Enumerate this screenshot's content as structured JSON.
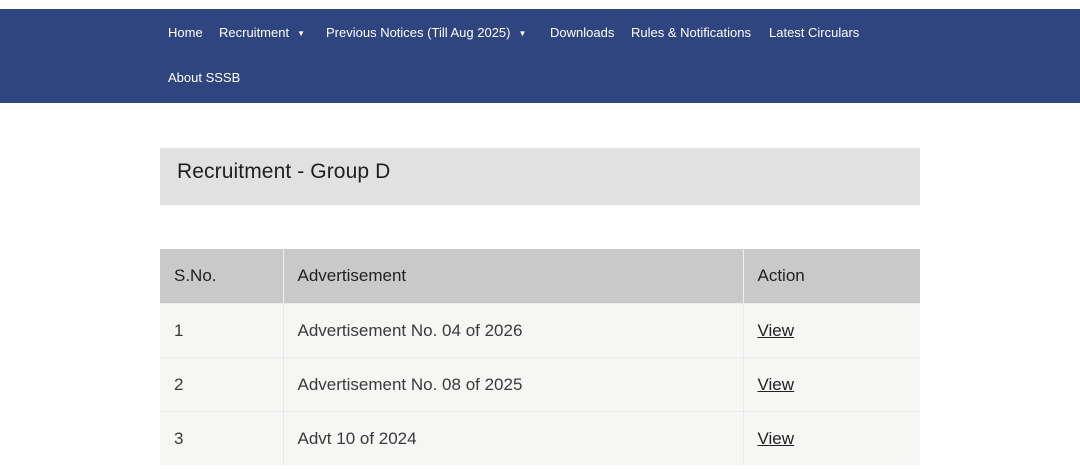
{
  "nav": {
    "items": [
      {
        "label": "Home",
        "has_dropdown": false
      },
      {
        "label": "Recruitment",
        "has_dropdown": true
      },
      {
        "label": "Previous Notices (Till Aug 2025)",
        "has_dropdown": true
      },
      {
        "label": "Downloads",
        "has_dropdown": false
      },
      {
        "label": "Rules & Notifications",
        "has_dropdown": false
      },
      {
        "label": "Latest Circulars",
        "has_dropdown": false
      },
      {
        "label": "About SSSB",
        "has_dropdown": false
      }
    ],
    "caret": "▼"
  },
  "page": {
    "title": "Recruitment - Group D"
  },
  "table": {
    "headers": [
      "S.No.",
      "Advertisement",
      "Action"
    ],
    "rows": [
      {
        "sno": "1",
        "advertisement": "Advertisement No. 04 of 2026",
        "action": "View"
      },
      {
        "sno": "2",
        "advertisement": "Advertisement No. 08 of 2025",
        "action": "View"
      },
      {
        "sno": "3",
        "advertisement": "Advt 10 of 2024",
        "action": "View"
      }
    ]
  },
  "colors": {
    "nav_bg": "#2e4580",
    "heading_bg": "#e1e1e1",
    "table_header_bg": "#c9c9c9",
    "table_row_bg": "#f6f6f5"
  }
}
